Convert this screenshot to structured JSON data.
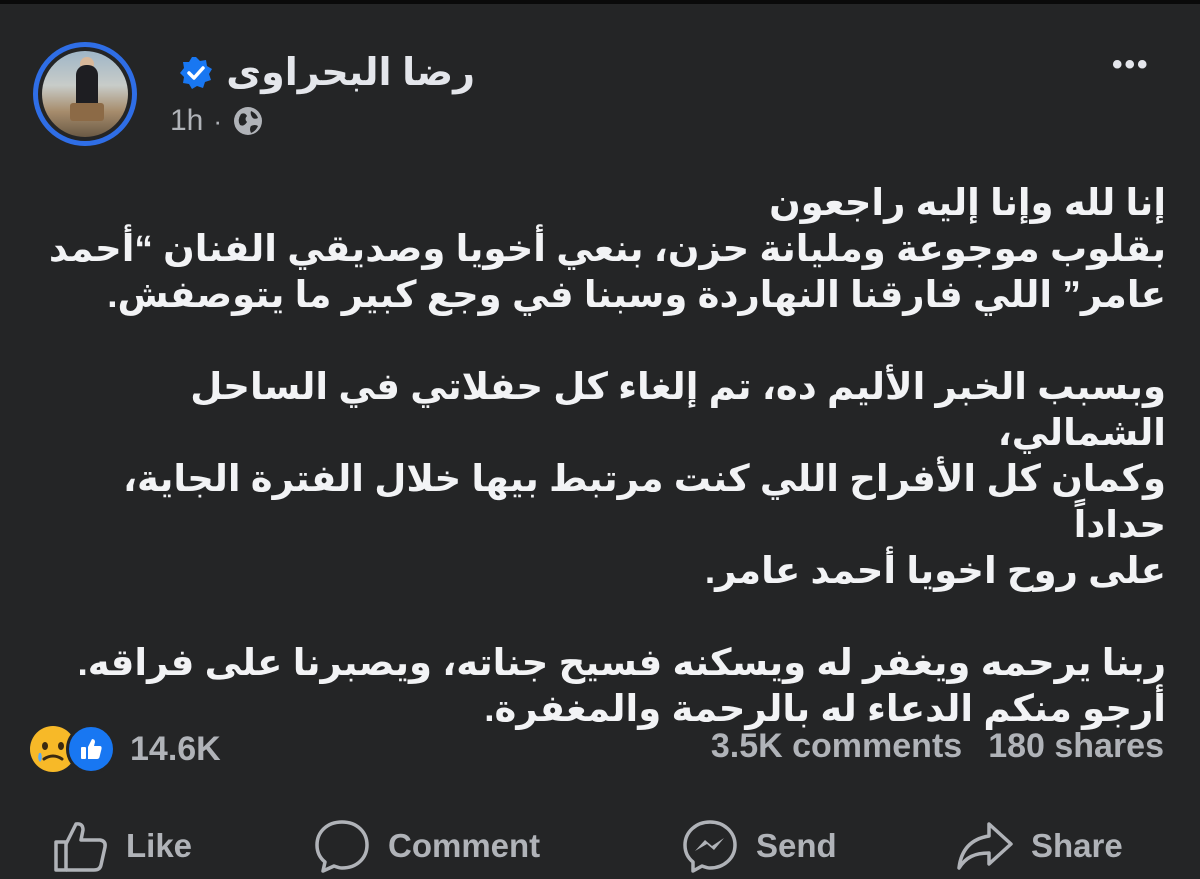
{
  "post": {
    "author_name": "رضا البحراوى",
    "time": "1h",
    "separator": "·",
    "more_label": "•••",
    "lines": [
      "إنا لله وإنا إليه راجعون",
      "بقلوب موجوعة ومليانة حزن، بنعي أخويا وصديقي الفنان “أحمد",
      "عامر” اللي فارقنا النهاردة وسبنا في وجع كبير ما يتوصفش.",
      "",
      "وبسبب الخبر الأليم ده، تم إلغاء كل حفلاتي في الساحل الشمالي،",
      "وكمان كل الأفراح اللي كنت مرتبط بيها خلال الفترة الجاية، حداداً",
      "على روح اخويا أحمد عامر.",
      "",
      "ربنا يرحمه ويغفر له ويسكنه فسيح جناته، ويصبرنا على فراقه.",
      "أرجو منكم الدعاء له بالرحمة والمغفرة."
    ]
  },
  "engagement": {
    "reaction_count": "14.6K",
    "comments": "3.5K comments",
    "shares": "180 shares"
  },
  "actions": {
    "like": "Like",
    "comment": "Comment",
    "send": "Send",
    "share": "Share"
  },
  "icons": {
    "verified": "verified-badge-icon",
    "globe": "globe-icon",
    "sad": "sad-reaction-icon",
    "like": "like-reaction-icon"
  },
  "colors": {
    "background": "#242526",
    "accent": "#1877f2",
    "ring": "#2f6ee6",
    "text_secondary": "#b0b3b8"
  }
}
